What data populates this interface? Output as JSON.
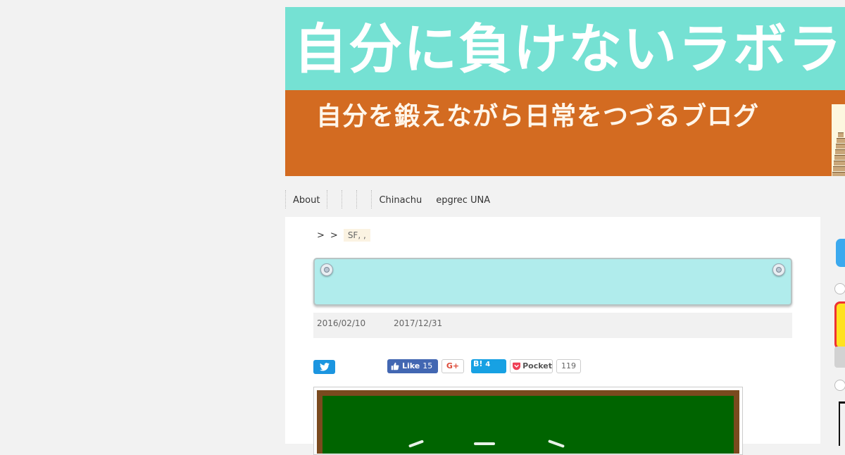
{
  "header": {
    "title": "自分に負けないラボラトリ",
    "subtitle": "自分を鍛えながら日常をつづるブログ",
    "colors": {
      "top_band": "#75e1d3",
      "bottom_band": "#d36b21"
    }
  },
  "nav": {
    "items": [
      "About",
      "",
      "",
      "",
      "Chinachu",
      "epgrec UNA"
    ]
  },
  "breadcrumb": {
    "separators": [
      ">",
      ">"
    ],
    "current": "SF, ,"
  },
  "post": {
    "date_posted": "2016/02/10",
    "date_updated": "2017/12/31"
  },
  "share": {
    "facebook_label": "Like",
    "facebook_count": "15",
    "gplus_label": "G+",
    "hatena_label": "B!",
    "hatena_count": "4",
    "pocket_label": "Pocket",
    "pocket_count": "119"
  },
  "icons": {
    "twitter": "twitter-bird-icon",
    "like": "thumbs-up-icon",
    "pocket": "pocket-icon",
    "pin": "pushpin-icon"
  }
}
